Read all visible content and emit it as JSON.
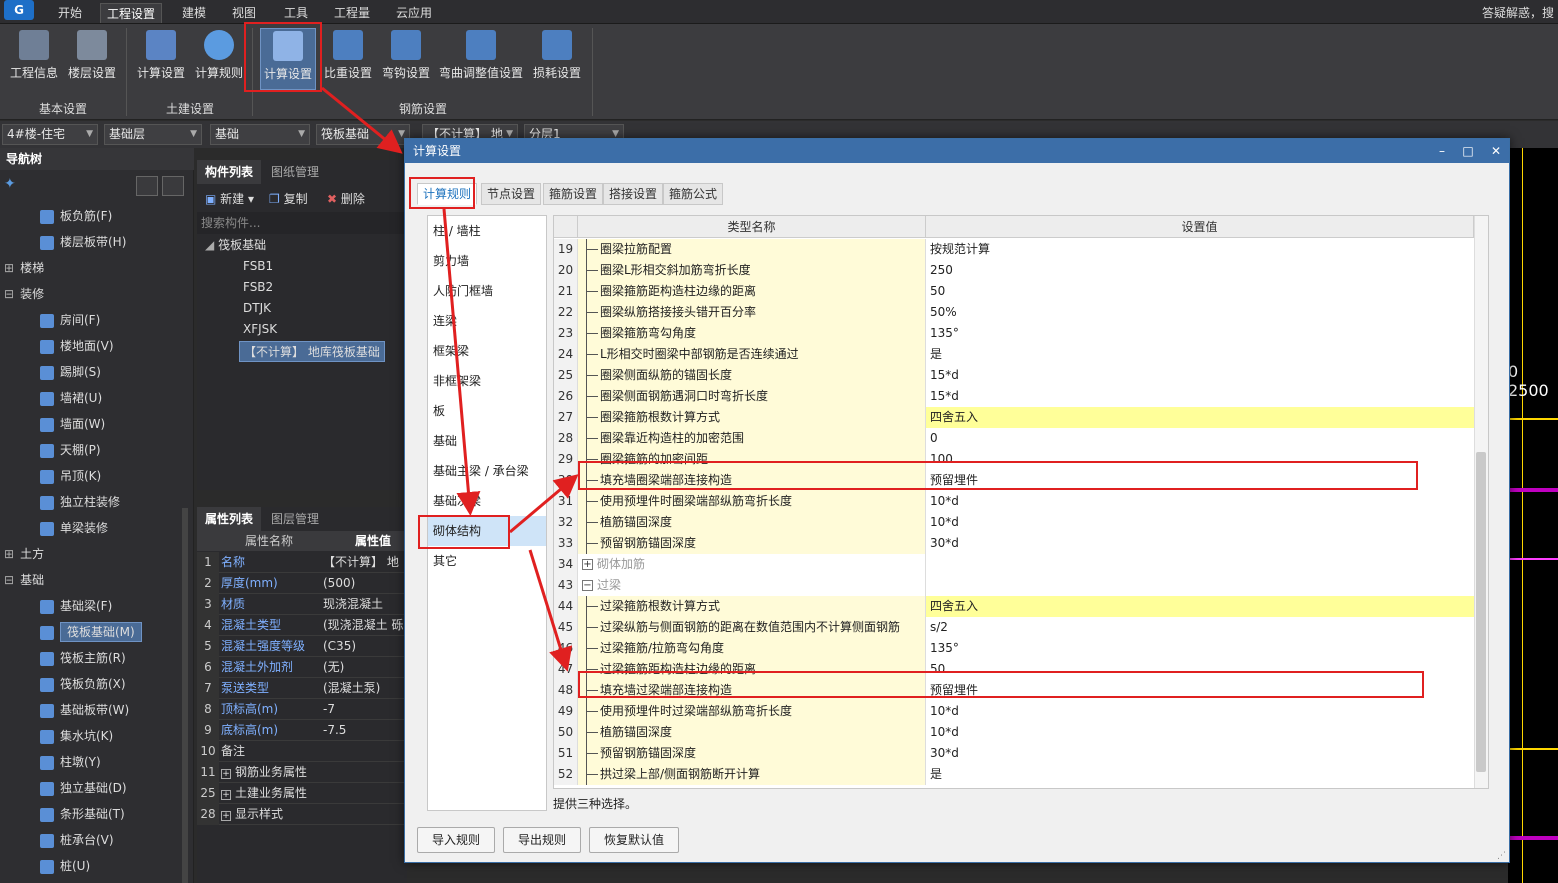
{
  "menu": {
    "logo": "G",
    "tabs": [
      "开始",
      "工程设置",
      "建模",
      "视图",
      "工具",
      "工程量",
      "云应用"
    ],
    "help": "答疑解惑，搜"
  },
  "ribbon": {
    "buttons": [
      "工程信息",
      "楼层设置",
      "计算设置",
      "计算规则",
      "计算设置",
      "比重设置",
      "弯钩设置",
      "弯曲调整值设置",
      "损耗设置"
    ],
    "groups": [
      "基本设置",
      "土建设置",
      "钢筋设置"
    ]
  },
  "dropdowns": [
    "4#楼-住宅",
    "基础层",
    "基础",
    "筏板基础",
    "【不计算】 地",
    "分层1"
  ],
  "nav": {
    "title": "导航树",
    "items": [
      {
        "label": "板负筋(F)",
        "type": "leaf"
      },
      {
        "label": "楼层板带(H)",
        "type": "leaf"
      },
      {
        "label": "楼梯",
        "type": "group",
        "sym": "⊞"
      },
      {
        "label": "装修",
        "type": "group",
        "sym": "⊟"
      },
      {
        "label": "房间(F)",
        "type": "leaf"
      },
      {
        "label": "楼地面(V)",
        "type": "leaf"
      },
      {
        "label": "踢脚(S)",
        "type": "leaf"
      },
      {
        "label": "墙裙(U)",
        "type": "leaf"
      },
      {
        "label": "墙面(W)",
        "type": "leaf"
      },
      {
        "label": "天棚(P)",
        "type": "leaf"
      },
      {
        "label": "吊顶(K)",
        "type": "leaf"
      },
      {
        "label": "独立柱装修",
        "type": "leaf"
      },
      {
        "label": "单梁装修",
        "type": "leaf"
      },
      {
        "label": "土方",
        "type": "group",
        "sym": "⊞"
      },
      {
        "label": "基础",
        "type": "group",
        "sym": "⊟"
      },
      {
        "label": "基础梁(F)",
        "type": "leaf"
      },
      {
        "label": "筏板基础(M)",
        "type": "leaf",
        "selected": true
      },
      {
        "label": "筏板主筋(R)",
        "type": "leaf"
      },
      {
        "label": "筏板负筋(X)",
        "type": "leaf"
      },
      {
        "label": "基础板带(W)",
        "type": "leaf"
      },
      {
        "label": "集水坑(K)",
        "type": "leaf"
      },
      {
        "label": "柱墩(Y)",
        "type": "leaf"
      },
      {
        "label": "独立基础(D)",
        "type": "leaf"
      },
      {
        "label": "条形基础(T)",
        "type": "leaf"
      },
      {
        "label": "桩承台(V)",
        "type": "leaf"
      },
      {
        "label": "桩(U)",
        "type": "leaf"
      }
    ]
  },
  "components": {
    "tabs": [
      "构件列表",
      "图纸管理"
    ],
    "toolbar": {
      "new": "新建",
      "copy": "复制",
      "delete": "删除"
    },
    "search_placeholder": "搜索构件...",
    "root": "筏板基础",
    "items": [
      "FSB1",
      "FSB2",
      "DTJK",
      "XFJSK",
      "【不计算】 地库筏板基础"
    ]
  },
  "properties": {
    "tabs": [
      "属性列表",
      "图层管理"
    ],
    "headers": [
      "属性名称",
      "属性值"
    ],
    "rows": [
      {
        "no": "1",
        "name": "名称",
        "value": "【不计算】 地"
      },
      {
        "no": "2",
        "name": "厚度(mm)",
        "value": "(500)"
      },
      {
        "no": "3",
        "name": "材质",
        "value": "现浇混凝土"
      },
      {
        "no": "4",
        "name": "混凝土类型",
        "value": "(现浇混凝土  砾"
      },
      {
        "no": "5",
        "name": "混凝土强度等级",
        "value": "(C35)"
      },
      {
        "no": "6",
        "name": "混凝土外加剂",
        "value": "(无)"
      },
      {
        "no": "7",
        "name": "泵送类型",
        "value": "(混凝土泵)"
      },
      {
        "no": "8",
        "name": "顶标高(m)",
        "value": "-7"
      },
      {
        "no": "9",
        "name": "底标高(m)",
        "value": "-7.5"
      },
      {
        "no": "10",
        "name": "备注",
        "value": ""
      },
      {
        "no": "11",
        "name": "钢筋业务属性",
        "value": "",
        "group": true
      },
      {
        "no": "25",
        "name": "土建业务属性",
        "value": "",
        "group": true
      },
      {
        "no": "28",
        "name": "显示样式",
        "value": "",
        "group": true
      }
    ]
  },
  "cad": {
    "text": "0 2500"
  },
  "dialog": {
    "title": "计算设置",
    "tabs": [
      "计算规则",
      "节点设置",
      "箍筋设置",
      "搭接设置",
      "箍筋公式"
    ],
    "categories": [
      "柱 / 墙柱",
      "剪力墙",
      "人防门框墙",
      "连梁",
      "框架梁",
      "非框架梁",
      "板",
      "基础",
      "基础主梁 / 承台梁",
      "基础次梁",
      "砌体结构",
      "其它"
    ],
    "active_category": "砌体结构",
    "grid_headers": [
      "类型名称",
      "设置值"
    ],
    "rows": [
      {
        "no": "19",
        "name": "圈梁拉筋配置",
        "value": "按规范计算"
      },
      {
        "no": "20",
        "name": "圈梁L形相交斜加筋弯折长度",
        "value": "250"
      },
      {
        "no": "21",
        "name": "圈梁箍筋距构造柱边缘的距离",
        "value": "50"
      },
      {
        "no": "22",
        "name": "圈梁纵筋搭接接头错开百分率",
        "value": "50%"
      },
      {
        "no": "23",
        "name": "圈梁箍筋弯勾角度",
        "value": "135°"
      },
      {
        "no": "24",
        "name": "L形相交时圈梁中部钢筋是否连续通过",
        "value": "是"
      },
      {
        "no": "25",
        "name": "圈梁侧面纵筋的锚固长度",
        "value": "15*d"
      },
      {
        "no": "26",
        "name": "圈梁侧面钢筋遇洞口时弯折长度",
        "value": "15*d"
      },
      {
        "no": "27",
        "name": "圈梁箍筋根数计算方式",
        "value": "四舍五入",
        "highlight": true
      },
      {
        "no": "28",
        "name": "圈梁靠近构造柱的加密范围",
        "value": "0"
      },
      {
        "no": "29",
        "name": "圈梁箍筋的加密间距",
        "value": "100"
      },
      {
        "no": "30",
        "name": "填充墙圈梁端部连接构造",
        "value": "预留埋件"
      },
      {
        "no": "31",
        "name": "使用预埋件时圈梁端部纵筋弯折长度",
        "value": "10*d"
      },
      {
        "no": "32",
        "name": "植筋锚固深度",
        "value": "10*d"
      },
      {
        "no": "33",
        "name": "预留钢筋锚固深度",
        "value": "30*d"
      },
      {
        "no": "34",
        "name": "砌体加筋",
        "value": "",
        "section": "+"
      },
      {
        "no": "43",
        "name": "过梁",
        "value": "",
        "section": "−"
      },
      {
        "no": "44",
        "name": "过梁箍筋根数计算方式",
        "value": "四舍五入",
        "highlight": true
      },
      {
        "no": "45",
        "name": "过梁纵筋与侧面钢筋的距离在数值范围内不计算侧面钢筋",
        "value": "s/2"
      },
      {
        "no": "46",
        "name": "过梁箍筋/拉筋弯勾角度",
        "value": "135°"
      },
      {
        "no": "47",
        "name": "过梁箍筋距构造柱边缘的距离",
        "value": "50"
      },
      {
        "no": "48",
        "name": "填充墙过梁端部连接构造",
        "value": "预留埋件"
      },
      {
        "no": "49",
        "name": "使用预埋件时过梁端部纵筋弯折长度",
        "value": "10*d"
      },
      {
        "no": "50",
        "name": "植筋锚固深度",
        "value": "10*d"
      },
      {
        "no": "51",
        "name": "预留钢筋锚固深度",
        "value": "30*d"
      },
      {
        "no": "52",
        "name": "拱过梁上部/侧面钢筋断开计算",
        "value": "是"
      }
    ],
    "hint": "提供三种选择。",
    "buttons": [
      "导入规则",
      "导出规则",
      "恢复默认值"
    ]
  }
}
